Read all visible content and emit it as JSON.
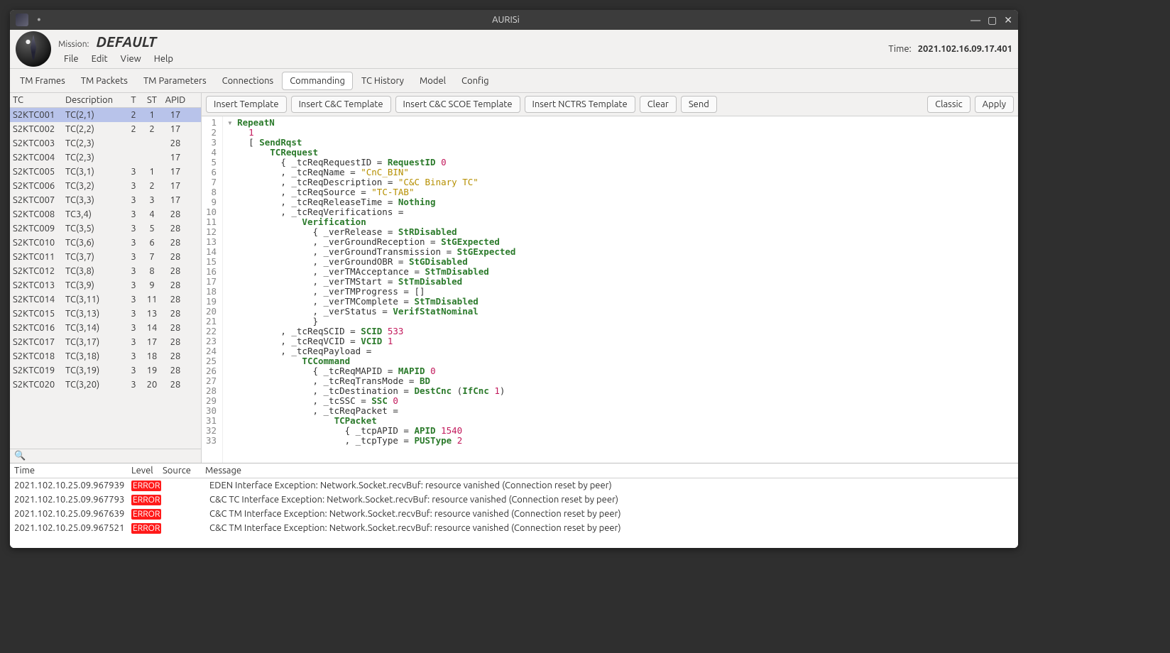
{
  "window": {
    "title": "AURISi"
  },
  "header": {
    "mission_label": "Mission:",
    "mission_name": "DEFAULT",
    "time_label": "Time:",
    "time_value": "2021.102.16.09.17.401"
  },
  "menu": {
    "file": "File",
    "edit": "Edit",
    "view": "View",
    "help": "Help"
  },
  "tabs": {
    "tm_frames": "TM Frames",
    "tm_packets": "TM Packets",
    "tm_parameters": "TM Parameters",
    "connections": "Connections",
    "commanding": "Commanding",
    "tc_history": "TC History",
    "model": "Model",
    "config": "Config"
  },
  "tc_table": {
    "headers": {
      "tc": "TC",
      "desc": "Description",
      "t": "T",
      "st": "ST",
      "apid": "APID"
    },
    "rows": [
      {
        "tc": "S2KTC001",
        "desc": "TC(2,1)",
        "t": "2",
        "st": "1",
        "apid": "17",
        "selected": true
      },
      {
        "tc": "S2KTC002",
        "desc": "TC(2,2)",
        "t": "2",
        "st": "2",
        "apid": "17"
      },
      {
        "tc": "S2KTC003",
        "desc": "TC(2,3)",
        "t": "",
        "st": "",
        "apid": "28"
      },
      {
        "tc": "S2KTC004",
        "desc": "TC(2,3)",
        "t": "",
        "st": "",
        "apid": "17"
      },
      {
        "tc": "S2KTC005",
        "desc": "TC(3,1)",
        "t": "3",
        "st": "1",
        "apid": "17"
      },
      {
        "tc": "S2KTC006",
        "desc": "TC(3,2)",
        "t": "3",
        "st": "2",
        "apid": "17"
      },
      {
        "tc": "S2KTC007",
        "desc": "TC(3,3)",
        "t": "3",
        "st": "3",
        "apid": "17"
      },
      {
        "tc": "S2KTC008",
        "desc": "TC3,4)",
        "t": "3",
        "st": "4",
        "apid": "28"
      },
      {
        "tc": "S2KTC009",
        "desc": "TC(3,5)",
        "t": "3",
        "st": "5",
        "apid": "28"
      },
      {
        "tc": "S2KTC010",
        "desc": "TC(3,6)",
        "t": "3",
        "st": "6",
        "apid": "28"
      },
      {
        "tc": "S2KTC011",
        "desc": "TC(3,7)",
        "t": "3",
        "st": "7",
        "apid": "28"
      },
      {
        "tc": "S2KTC012",
        "desc": "TC(3,8)",
        "t": "3",
        "st": "8",
        "apid": "28"
      },
      {
        "tc": "S2KTC013",
        "desc": "TC(3,9)",
        "t": "3",
        "st": "9",
        "apid": "28"
      },
      {
        "tc": "S2KTC014",
        "desc": "TC(3,11)",
        "t": "3",
        "st": "11",
        "apid": "28"
      },
      {
        "tc": "S2KTC015",
        "desc": "TC(3,13)",
        "t": "3",
        "st": "13",
        "apid": "28"
      },
      {
        "tc": "S2KTC016",
        "desc": "TC(3,14)",
        "t": "3",
        "st": "14",
        "apid": "28"
      },
      {
        "tc": "S2KTC017",
        "desc": "TC(3,17)",
        "t": "3",
        "st": "17",
        "apid": "28"
      },
      {
        "tc": "S2KTC018",
        "desc": "TC(3,18)",
        "t": "3",
        "st": "18",
        "apid": "28"
      },
      {
        "tc": "S2KTC019",
        "desc": "TC(3,19)",
        "t": "3",
        "st": "19",
        "apid": "28"
      },
      {
        "tc": "S2KTC020",
        "desc": "TC(3,20)",
        "t": "3",
        "st": "20",
        "apid": "28"
      }
    ]
  },
  "editor_toolbar": {
    "insert_template": "Insert Template",
    "insert_cc_template": "Insert C&C Template",
    "insert_cc_scoe_template": "Insert C&C SCOE Template",
    "insert_nctrs_template": "Insert NCTRS Template",
    "clear": "Clear",
    "send": "Send",
    "classic": "Classic",
    "apply": "Apply"
  },
  "code_lines": [
    [
      {
        "cls": "fold",
        "t": "▾"
      },
      {
        "cls": "t-type",
        "t": "RepeatN"
      }
    ],
    [
      {
        "cls": "t-plain",
        "t": "    "
      },
      {
        "cls": "t-num",
        "t": "1"
      }
    ],
    [
      {
        "cls": "t-plain",
        "t": "    [ "
      },
      {
        "cls": "t-type",
        "t": "SendRqst"
      }
    ],
    [
      {
        "cls": "t-plain",
        "t": "        "
      },
      {
        "cls": "t-type",
        "t": "TCRequest"
      }
    ],
    [
      {
        "cls": "t-plain",
        "t": "          { _tcReqRequestID = "
      },
      {
        "cls": "t-type",
        "t": "RequestID"
      },
      {
        "cls": "t-plain",
        "t": " "
      },
      {
        "cls": "t-num",
        "t": "0"
      }
    ],
    [
      {
        "cls": "t-plain",
        "t": "          , _tcReqName = "
      },
      {
        "cls": "t-str",
        "t": "\"CnC_BIN\""
      }
    ],
    [
      {
        "cls": "t-plain",
        "t": "          , _tcReqDescription = "
      },
      {
        "cls": "t-str",
        "t": "\"C&C Binary TC\""
      }
    ],
    [
      {
        "cls": "t-plain",
        "t": "          , _tcReqSource = "
      },
      {
        "cls": "t-str",
        "t": "\"TC-TAB\""
      }
    ],
    [
      {
        "cls": "t-plain",
        "t": "          , _tcReqReleaseTime = "
      },
      {
        "cls": "t-type",
        "t": "Nothing"
      }
    ],
    [
      {
        "cls": "t-plain",
        "t": "          , _tcReqVerifications ="
      }
    ],
    [
      {
        "cls": "t-plain",
        "t": "              "
      },
      {
        "cls": "t-type",
        "t": "Verification"
      }
    ],
    [
      {
        "cls": "t-plain",
        "t": "                { _verRelease = "
      },
      {
        "cls": "t-type",
        "t": "StRDisabled"
      }
    ],
    [
      {
        "cls": "t-plain",
        "t": "                , _verGroundReception = "
      },
      {
        "cls": "t-type",
        "t": "StGExpected"
      }
    ],
    [
      {
        "cls": "t-plain",
        "t": "                , _verGroundTransmission = "
      },
      {
        "cls": "t-type",
        "t": "StGExpected"
      }
    ],
    [
      {
        "cls": "t-plain",
        "t": "                , _verGroundOBR = "
      },
      {
        "cls": "t-type",
        "t": "StGDisabled"
      }
    ],
    [
      {
        "cls": "t-plain",
        "t": "                , _verTMAcceptance = "
      },
      {
        "cls": "t-type",
        "t": "StTmDisabled"
      }
    ],
    [
      {
        "cls": "t-plain",
        "t": "                , _verTMStart = "
      },
      {
        "cls": "t-type",
        "t": "StTmDisabled"
      }
    ],
    [
      {
        "cls": "t-plain",
        "t": "                , _verTMProgress = []"
      }
    ],
    [
      {
        "cls": "t-plain",
        "t": "                , _verTMComplete = "
      },
      {
        "cls": "t-type",
        "t": "StTmDisabled"
      }
    ],
    [
      {
        "cls": "t-plain",
        "t": "                , _verStatus = "
      },
      {
        "cls": "t-type",
        "t": "VerifStatNominal"
      }
    ],
    [
      {
        "cls": "t-plain",
        "t": "                }"
      }
    ],
    [
      {
        "cls": "t-plain",
        "t": "          , _tcReqSCID = "
      },
      {
        "cls": "t-type",
        "t": "SCID"
      },
      {
        "cls": "t-plain",
        "t": " "
      },
      {
        "cls": "t-num",
        "t": "533"
      }
    ],
    [
      {
        "cls": "t-plain",
        "t": "          , _tcReqVCID = "
      },
      {
        "cls": "t-type",
        "t": "VCID"
      },
      {
        "cls": "t-plain",
        "t": " "
      },
      {
        "cls": "t-num",
        "t": "1"
      }
    ],
    [
      {
        "cls": "t-plain",
        "t": "          , _tcReqPayload ="
      }
    ],
    [
      {
        "cls": "t-plain",
        "t": "              "
      },
      {
        "cls": "t-type",
        "t": "TCCommand"
      }
    ],
    [
      {
        "cls": "t-plain",
        "t": "                { _tcReqMAPID = "
      },
      {
        "cls": "t-type",
        "t": "MAPID"
      },
      {
        "cls": "t-plain",
        "t": " "
      },
      {
        "cls": "t-num",
        "t": "0"
      }
    ],
    [
      {
        "cls": "t-plain",
        "t": "                , _tcReqTransMode = "
      },
      {
        "cls": "t-type",
        "t": "BD"
      }
    ],
    [
      {
        "cls": "t-plain",
        "t": "                , _tcDestination = "
      },
      {
        "cls": "t-type",
        "t": "DestCnc"
      },
      {
        "cls": "t-plain",
        "t": " ("
      },
      {
        "cls": "t-type",
        "t": "IfCnc"
      },
      {
        "cls": "t-plain",
        "t": " "
      },
      {
        "cls": "t-num",
        "t": "1"
      },
      {
        "cls": "t-plain",
        "t": ")"
      }
    ],
    [
      {
        "cls": "t-plain",
        "t": "                , _tcSSC = "
      },
      {
        "cls": "t-type",
        "t": "SSC"
      },
      {
        "cls": "t-plain",
        "t": " "
      },
      {
        "cls": "t-num",
        "t": "0"
      }
    ],
    [
      {
        "cls": "t-plain",
        "t": "                , _tcReqPacket ="
      }
    ],
    [
      {
        "cls": "t-plain",
        "t": "                    "
      },
      {
        "cls": "t-type",
        "t": "TCPacket"
      }
    ],
    [
      {
        "cls": "t-plain",
        "t": "                      { _tcpAPID = "
      },
      {
        "cls": "t-type",
        "t": "APID"
      },
      {
        "cls": "t-plain",
        "t": " "
      },
      {
        "cls": "t-num",
        "t": "1540"
      }
    ],
    [
      {
        "cls": "t-plain",
        "t": "                      , _tcpType = "
      },
      {
        "cls": "t-type",
        "t": "PUSType"
      },
      {
        "cls": "t-plain",
        "t": " "
      },
      {
        "cls": "t-num",
        "t": "2"
      }
    ]
  ],
  "log": {
    "headers": {
      "time": "Time",
      "level": "Level",
      "source": "Source",
      "message": "Message"
    },
    "rows": [
      {
        "time": "2021.102.10.25.09.967939",
        "level": "ERROR",
        "source": "",
        "message": "EDEN Interface Exception: Network.Socket.recvBuf: resource vanished (Connection reset by peer)"
      },
      {
        "time": "2021.102.10.25.09.967793",
        "level": "ERROR",
        "source": "",
        "message": "C&C TC Interface Exception: Network.Socket.recvBuf: resource vanished (Connection reset by peer)"
      },
      {
        "time": "2021.102.10.25.09.967639",
        "level": "ERROR",
        "source": "",
        "message": "C&C TM Interface Exception: Network.Socket.recvBuf: resource vanished (Connection reset by peer)"
      },
      {
        "time": "2021.102.10.25.09.967521",
        "level": "ERROR",
        "source": "",
        "message": "C&C TM Interface Exception: Network.Socket.recvBuf: resource vanished (Connection reset by peer)"
      }
    ]
  }
}
